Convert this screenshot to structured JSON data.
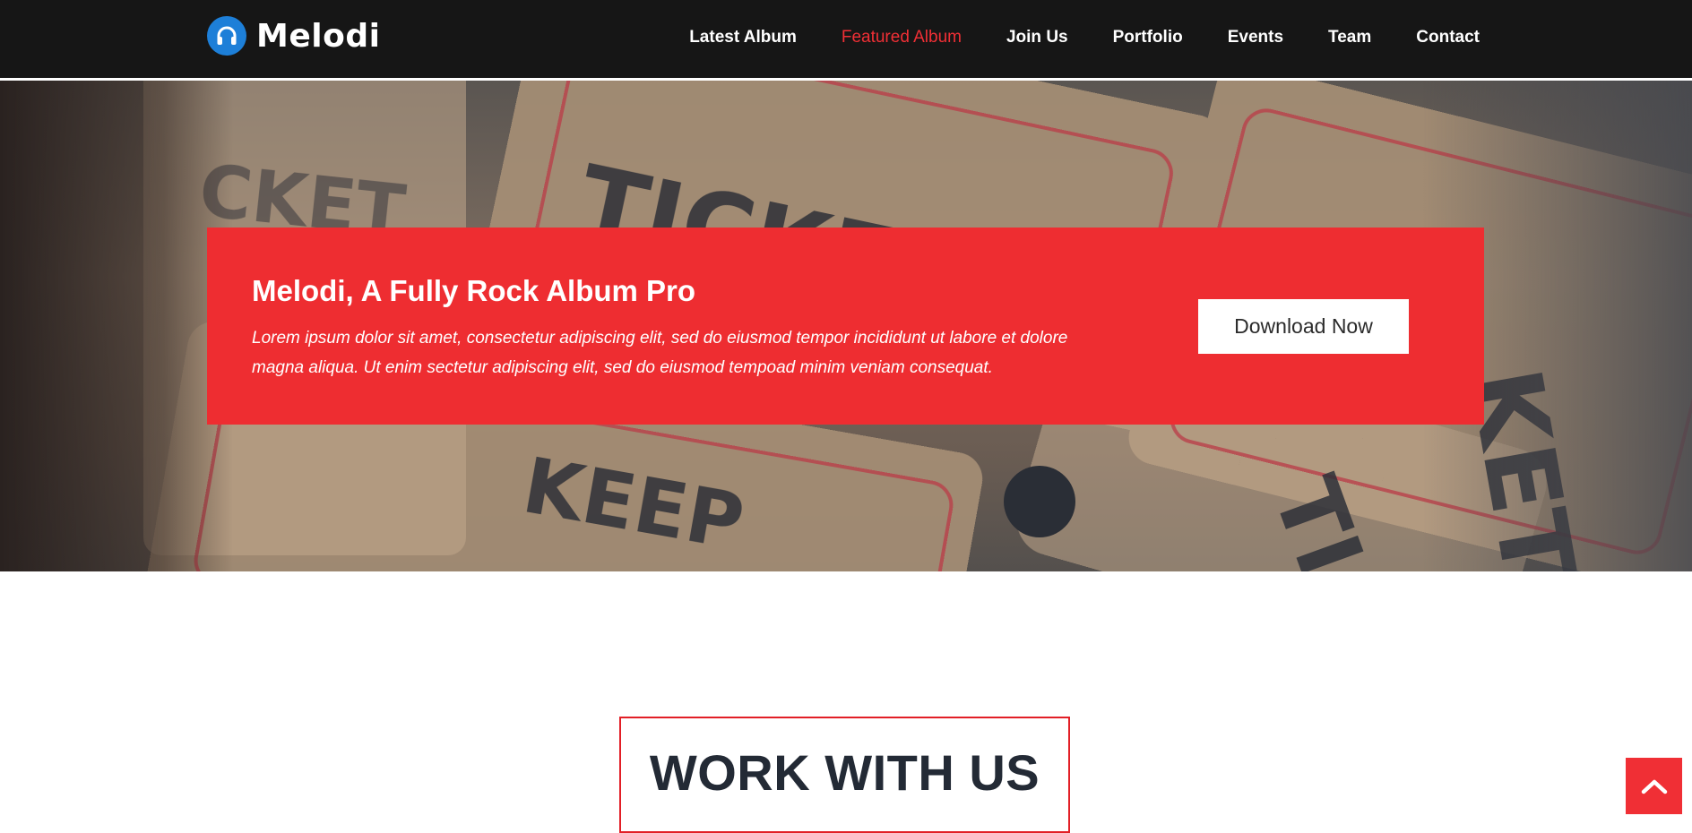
{
  "brand": {
    "name": "Melodi",
    "icon": "headphones-icon",
    "icon_color": "#1d7fd8"
  },
  "nav": {
    "items": [
      {
        "label": "Latest Album"
      },
      {
        "label": "Featured Album",
        "active": true
      },
      {
        "label": "Join Us"
      },
      {
        "label": "Portfolio"
      },
      {
        "label": "Events"
      },
      {
        "label": "Team"
      },
      {
        "label": "Contact"
      }
    ]
  },
  "hero": {
    "background_icon": "ticket-photo",
    "promo": {
      "title": "Melodi, A Fully Rock Album Pro",
      "description": "Lorem ipsum dolor sit amet, consectetur adipiscing elit, sed do eiusmod tempor incididunt ut labore et dolore magna aliqua. Ut enim sectetur adipiscing elit, sed do eiusmod tempoad minim veniam consequat.",
      "button_label": "Download Now"
    }
  },
  "section": {
    "title": "WORK WITH US"
  },
  "back_to_top": {
    "icon": "chevron-up-icon"
  },
  "colors": {
    "accent": "#ee2d31",
    "header_bg": "#161616",
    "heading_text": "#232a35"
  }
}
